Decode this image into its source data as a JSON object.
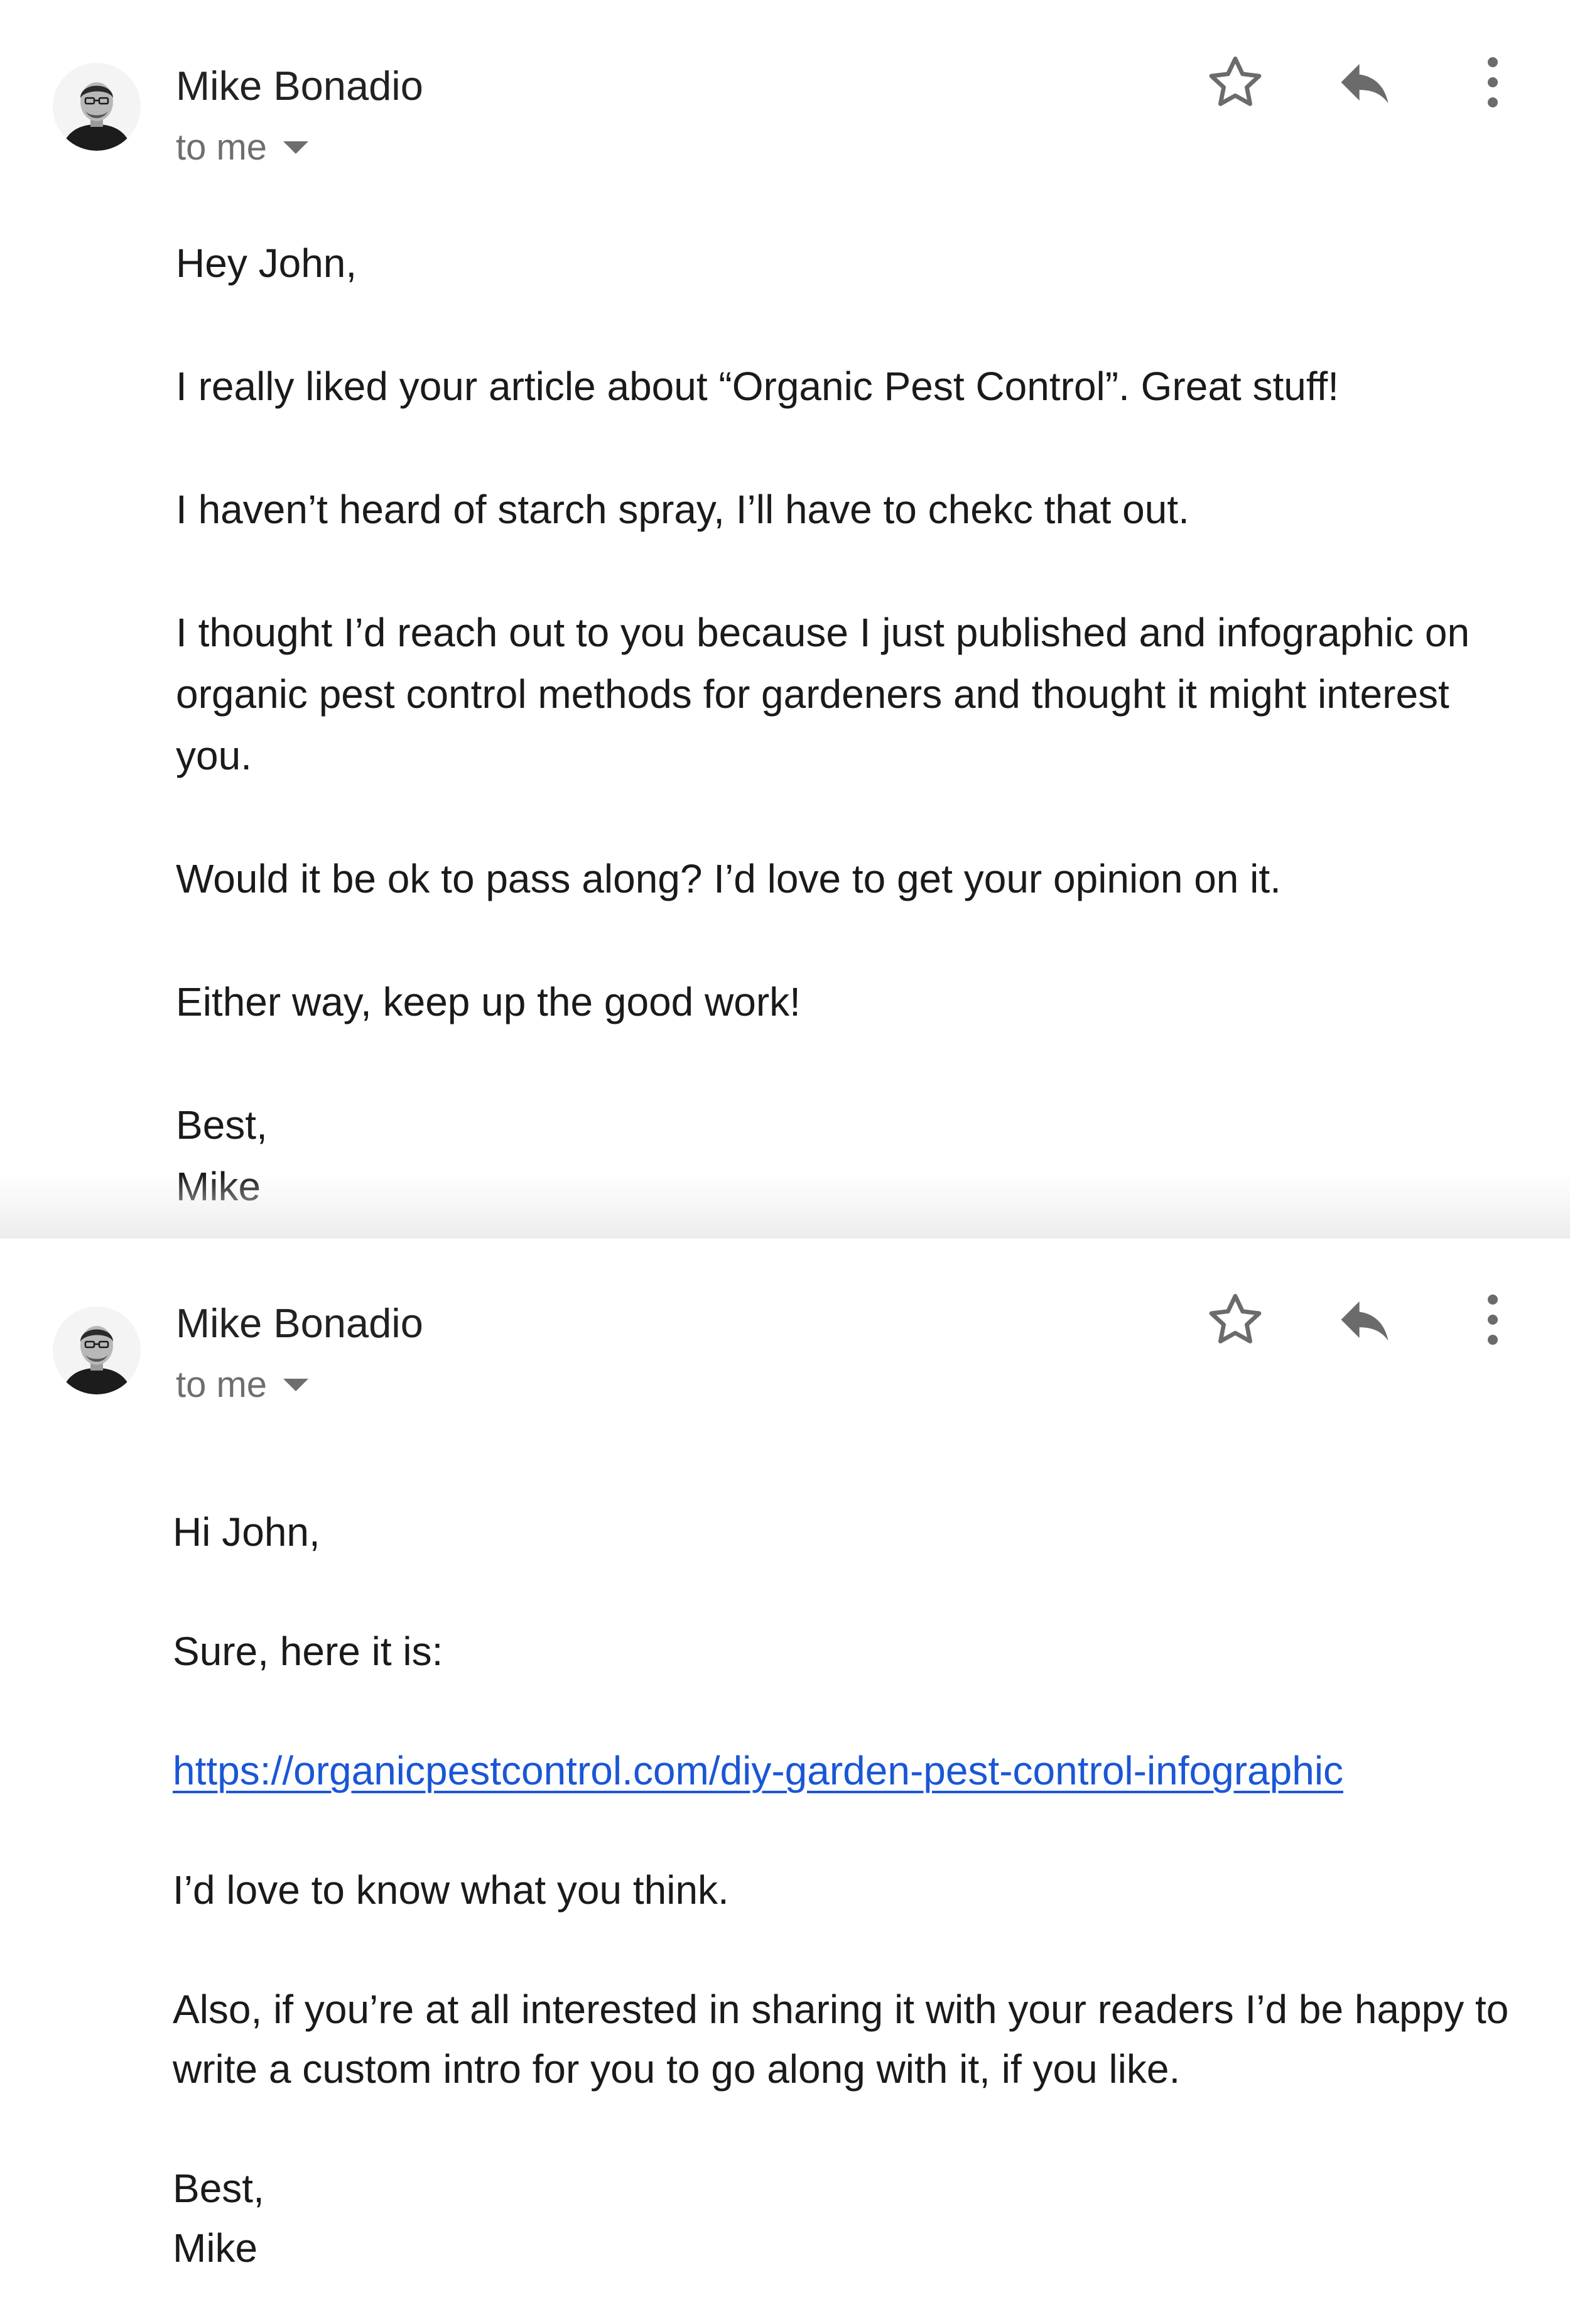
{
  "emails": [
    {
      "sender": "Mike Bonadio",
      "recipient": "to me",
      "actions": {
        "star_icon": "star-outline-icon",
        "reply_icon": "reply-arrow-icon",
        "more_icon": "more-vertical-icon"
      },
      "body": {
        "greeting": "Hey John,",
        "para1": "I really liked your article about “Organic Pest Control”. Great stuff!",
        "para2": "I haven’t heard of starch spray, I’ll have to chekc that out.",
        "para3_line1": "I thought I’d reach out to you because I just published and infographic on",
        "para3_line2": "organic pest control methods for gardeners and thought it might interest",
        "para3_line3": "you.",
        "para4": "Would it be ok to pass along? I’d love to get your opinion on it.",
        "para5": "Either way, keep up the good work!",
        "signoff": "Best,",
        "signature": "Mike"
      }
    },
    {
      "sender": "Mike Bonadio",
      "recipient": "to me",
      "actions": {
        "star_icon": "star-outline-icon",
        "reply_icon": "reply-arrow-icon",
        "more_icon": "more-vertical-icon"
      },
      "body": {
        "greeting": "Hi John,",
        "para1": "Sure, here it is:",
        "link": "https://organicpestcontrol.com/diy-garden-pest-control-infographic",
        "para2": "I’d love to know what you think.",
        "para3_line1": "Also, if you’re at all interested in sharing it with your readers I’d be happy to",
        "para3_line2": "write a custom intro for you to go along with it, if you like.",
        "signoff": "Best,",
        "signature": "Mike"
      }
    }
  ],
  "colors": {
    "link": "#1a56d6",
    "icon": "#6b6b6b",
    "secondary_text": "#6e6e6e",
    "divider_shade": "#ececec"
  }
}
